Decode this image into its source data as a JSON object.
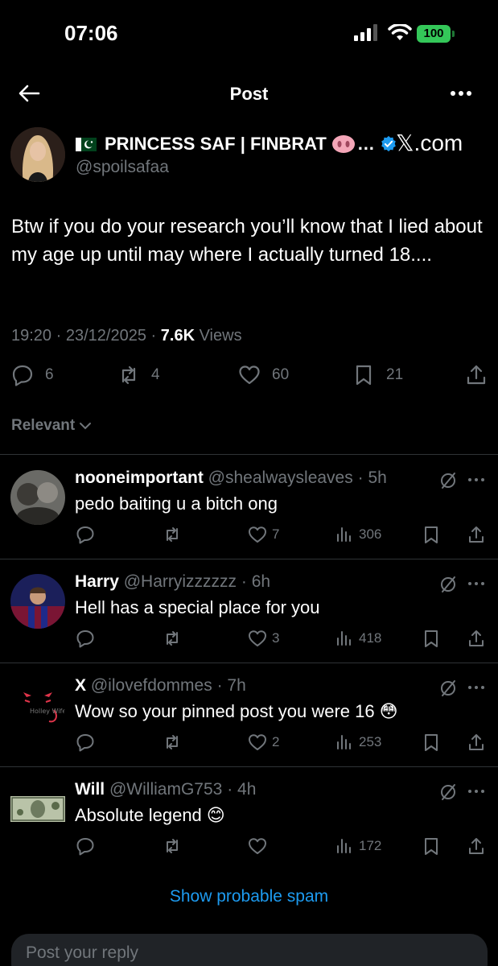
{
  "status_bar": {
    "time": "07:06",
    "battery": "100"
  },
  "nav": {
    "title": "Post"
  },
  "post": {
    "author_name": "PRINCESS SAF | FINBRAT",
    "ellipsis": "…",
    "handle": "@spoilsafaa",
    "source_label": "𝕏.com",
    "text": "Btw if you do your research you’ll know that I lied about my age up until may where I actually turned 18....",
    "time": "19:20",
    "date": "23/12/2025",
    "views_count": "7.6K",
    "views_label": "Views",
    "separator": "·",
    "stats": {
      "replies": "6",
      "reposts": "4",
      "likes": "60",
      "bookmarks": "21"
    }
  },
  "sort": {
    "label": "Relevant"
  },
  "replies": [
    {
      "name": "nooneimportant",
      "handle": "@shealwaysleaves",
      "age": "5h",
      "text": "pedo baiting u a bitch ong",
      "emoji": "",
      "likes": "7",
      "views": "306"
    },
    {
      "name": "Harry",
      "handle": "@Harryizzzzzz",
      "age": "6h",
      "text": "Hell has a special place for you",
      "emoji": "",
      "likes": "3",
      "views": "418"
    },
    {
      "name": "X",
      "handle": "@ilovefdommes",
      "age": "7h",
      "text": "Wow so your pinned post you were 16",
      "emoji": "😳",
      "likes": "2",
      "views": "253",
      "avatar_text": "Holley Wife"
    },
    {
      "name": "Will",
      "handle": "@WilliamG753",
      "age": "4h",
      "text": "Absolute legend",
      "emoji": "😊",
      "likes": "",
      "views": "172"
    }
  ],
  "spam_link": "Show probable spam",
  "reply_box": {
    "placeholder": "Post your reply"
  },
  "colors": {
    "background": "#000000",
    "text": "#e7e9ea",
    "muted": "#71767b",
    "accent": "#1d9bf0",
    "divider": "#2f3336",
    "battery": "#34c759"
  },
  "icons": [
    "back-arrow-icon",
    "more-icon",
    "verified-icon",
    "reply-icon",
    "repost-icon",
    "like-icon",
    "bookmark-icon",
    "share-icon",
    "views-icon",
    "mute-icon",
    "chevron-down-icon"
  ]
}
